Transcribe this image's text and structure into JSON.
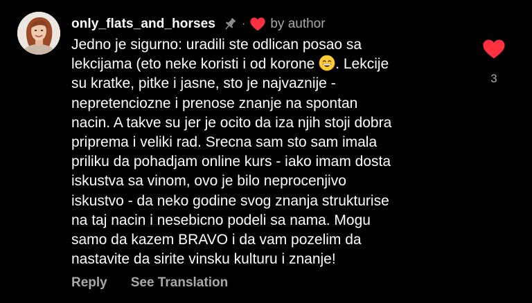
{
  "comment": {
    "username": "only_flats_and_horses",
    "separator": "·",
    "author_label": "by author",
    "body_lines": [
      "Jedno je sigurno: uradili ste odlican posao sa",
      "lekcijama (eto neke koristi i od korone",
      ". Lekcije",
      "su kratke, pitke i jasne, sto je najvaznije -",
      "nepretenciozne i prenose znanje na spontan",
      "nacin. A takve su jer je ocito da iza njih stoji dobra",
      "priprema i veliki rad. Srecna sam sto sam imala",
      "priliku da pohadjam online kurs - iako imam dosta",
      "iskustva sa vinom, ovo je bilo neprocenjivo",
      "iskustvo - da neko godine svog znanja strukturise",
      "na taj nacin i nesebicno podeli sa nama. Mogu",
      "samo da kazem BRAVO i da vam pozelim da",
      "nastavite da sirite vinsku kulturu i znanje!"
    ],
    "emoji": "grinning-face-with-smiling-eyes",
    "reply_label": "Reply",
    "translate_label": "See Translation",
    "like_count": "3",
    "icons": {
      "pin": "pin-icon",
      "author_heart": "heart-icon",
      "like_heart": "heart-icon"
    }
  },
  "colors": {
    "background": "#000000",
    "text_primary": "#ffffff",
    "text_secondary": "#a8a8a8",
    "heart": "#ff3040"
  }
}
